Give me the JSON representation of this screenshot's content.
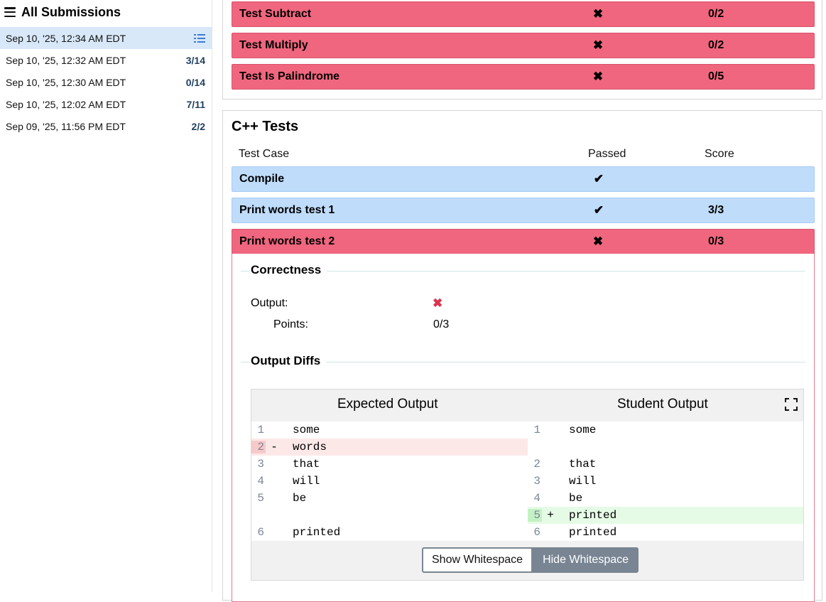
{
  "sidebar": {
    "title": "All Submissions",
    "items": [
      {
        "date": "Sep 10, '25, 12:34 AM EDT",
        "score": "",
        "selected": true
      },
      {
        "date": "Sep 10, '25, 12:32 AM EDT",
        "score": "3/14"
      },
      {
        "date": "Sep 10, '25, 12:30 AM EDT",
        "score": "0/14"
      },
      {
        "date": "Sep 10, '25, 12:02 AM EDT",
        "score": "7/11"
      },
      {
        "date": "Sep 09, '25, 11:56 PM EDT",
        "score": "2/2"
      }
    ]
  },
  "top_tests": [
    {
      "name": "Test Subtract",
      "mark": "✖",
      "score": "0/2"
    },
    {
      "name": "Test Multiply",
      "mark": "✖",
      "score": "0/2"
    },
    {
      "name": "Test Is Palindrome",
      "mark": "✖",
      "score": "0/5"
    }
  ],
  "cpp": {
    "title": "C++ Tests",
    "col_test_case": "Test Case",
    "col_passed": "Passed",
    "col_score": "Score",
    "tests": [
      {
        "name": "Compile",
        "mark": "✔",
        "score": ""
      },
      {
        "name": "Print words test 1",
        "mark": "✔",
        "score": "3/3"
      },
      {
        "name": "Print words test 2",
        "mark": "✖",
        "score": "0/3"
      }
    ]
  },
  "detail": {
    "correctness_legend": "Correctness",
    "output_label": "Output:",
    "output_mark": "✖",
    "points_label": "Points:",
    "points_value": "0/3",
    "diffs_legend": "Output Diffs",
    "expected_header": "Expected Output",
    "student_header": "Student Output",
    "show_whitespace": "Show Whitespace",
    "hide_whitespace": "Hide Whitespace"
  },
  "diff": {
    "expected": [
      {
        "ln": "1",
        "sign": "",
        "text": "some",
        "type": "same"
      },
      {
        "ln": "2",
        "sign": "-",
        "text": "words",
        "type": "removed"
      },
      {
        "ln": "3",
        "sign": "",
        "text": "that",
        "type": "same"
      },
      {
        "ln": "4",
        "sign": "",
        "text": "will",
        "type": "same"
      },
      {
        "ln": "5",
        "sign": "",
        "text": "be",
        "type": "same"
      },
      {
        "ln": "",
        "sign": "",
        "text": "",
        "type": "blank"
      },
      {
        "ln": "6",
        "sign": "",
        "text": "printed",
        "type": "same"
      }
    ],
    "student": [
      {
        "ln": "1",
        "sign": "",
        "text": "some",
        "type": "same"
      },
      {
        "ln": "",
        "sign": "",
        "text": "",
        "type": "blank"
      },
      {
        "ln": "2",
        "sign": "",
        "text": "that",
        "type": "same"
      },
      {
        "ln": "3",
        "sign": "",
        "text": "will",
        "type": "same"
      },
      {
        "ln": "4",
        "sign": "",
        "text": "be",
        "type": "same"
      },
      {
        "ln": "5",
        "sign": "+",
        "text": "printed",
        "type": "added"
      },
      {
        "ln": "6",
        "sign": "",
        "text": "printed",
        "type": "same"
      }
    ]
  }
}
